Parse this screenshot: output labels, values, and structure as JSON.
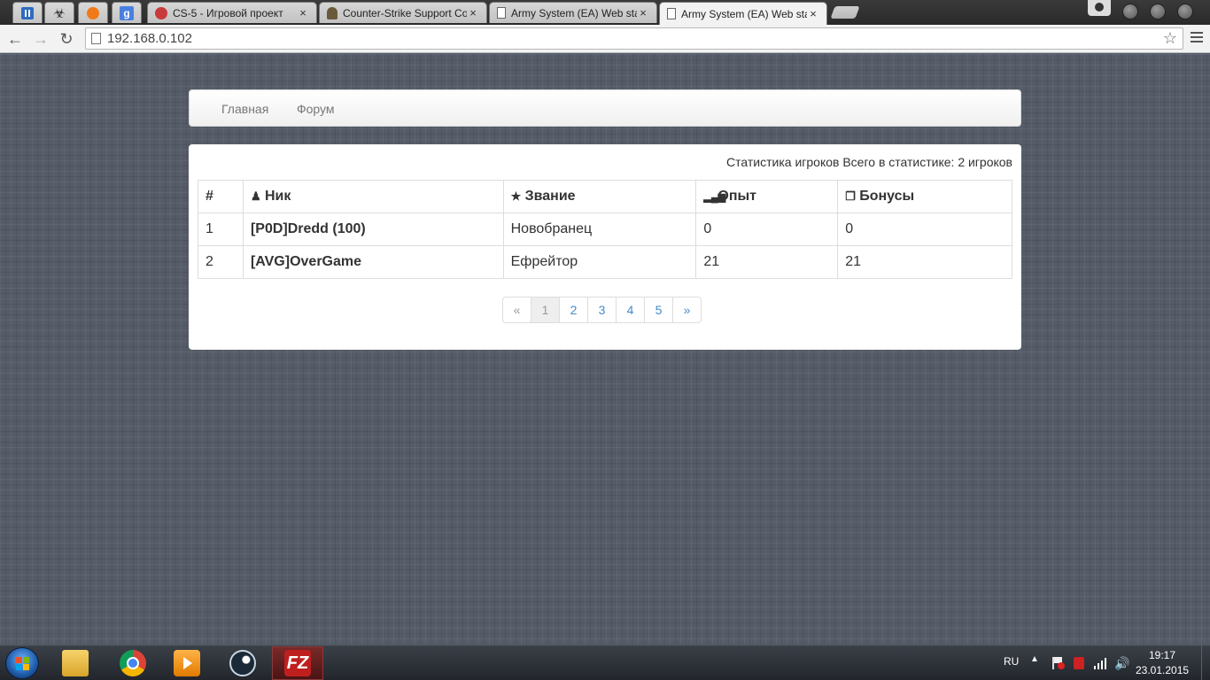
{
  "browser": {
    "tabs": [
      {
        "title": "CS-5 - Игровой проект"
      },
      {
        "title": "Counter-Strike Support Co"
      },
      {
        "title": "Army System (EA) Web sta"
      },
      {
        "title": "Army System (EA) Web sta",
        "active": true
      }
    ],
    "close_glyph": "×",
    "address": "192.168.0.102"
  },
  "navbar": {
    "items": [
      "Главная",
      "Форум"
    ]
  },
  "stats": {
    "caption": "Статистика игроков Всего в статистике: 2 игроков",
    "columns": {
      "num": "#",
      "nick": "Ник",
      "rank": "Звание",
      "exp": "Опыт",
      "bonus": "Бонусы"
    },
    "rows": [
      {
        "num": "1",
        "nick": "[P0D]Dredd (100)",
        "rank": "Новобранец",
        "exp": "0",
        "bonus": "0"
      },
      {
        "num": "2",
        "nick": "[AVG]OverGame",
        "rank": "Ефрейтор",
        "exp": "21",
        "bonus": "21"
      }
    ]
  },
  "pagination": {
    "prev": "«",
    "pages": [
      "1",
      "2",
      "3",
      "4",
      "5"
    ],
    "next": "»"
  },
  "taskbar": {
    "lang": "RU",
    "time": "19:17",
    "date": "23.01.2015",
    "filezilla_label": "FZ"
  }
}
